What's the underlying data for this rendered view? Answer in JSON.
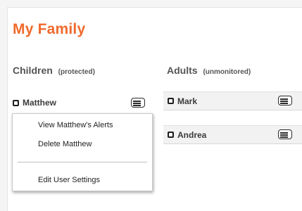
{
  "page": {
    "title": "My Family"
  },
  "children": {
    "heading": "Children",
    "note": "(protected)",
    "members": [
      {
        "name": "Matthew"
      }
    ]
  },
  "adults": {
    "heading": "Adults",
    "note": "(unmonitored)",
    "members": [
      {
        "name": "Mark"
      },
      {
        "name": "Andrea"
      }
    ]
  },
  "context_menu": {
    "items": [
      {
        "label": "View Matthew's Alerts"
      },
      {
        "label": "Delete Matthew"
      },
      {
        "label": "Edit User Settings"
      }
    ]
  },
  "icons": {
    "member": "user-icon",
    "menu": "list-menu-icon"
  },
  "colors": {
    "title": "#ef6a2c",
    "adult_row_bg": "#f2f2f2"
  }
}
